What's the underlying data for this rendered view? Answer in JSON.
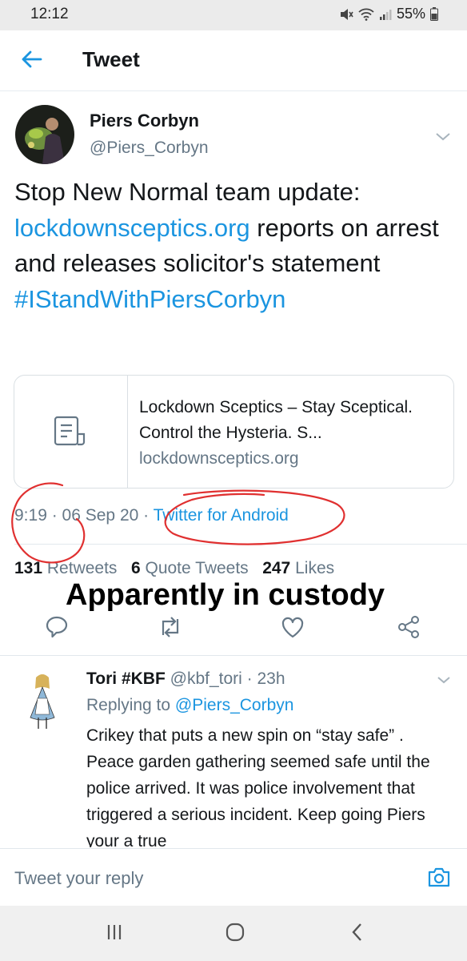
{
  "status_bar": {
    "time": "12:12",
    "battery": "55%"
  },
  "header": {
    "title": "Tweet"
  },
  "tweet": {
    "author_name": "Piers Corbyn",
    "author_handle": "@Piers_Corbyn",
    "text_part1": "Stop New Normal team update: ",
    "text_link": "lockdownsceptics.org",
    "text_part2": " reports on arrest and releases solicitor's statement ",
    "hashtag": "#IStandWithPiersCorbyn",
    "card": {
      "title": "Lockdown Sceptics – Stay Sceptical. Control the Hysteria. S...",
      "url": "lockdownsceptics.org"
    },
    "time": "9:19",
    "date": "06 Sep 20",
    "source": "Twitter for Android",
    "stats": {
      "retweets_count": "131",
      "retweets_label": "Retweets",
      "quotes_count": "6",
      "quotes_label": "Quote Tweets",
      "likes_count": "247",
      "likes_label": "Likes"
    }
  },
  "overlay_caption": "Apparently in custody",
  "reply": {
    "author_name": "Tori #KBF",
    "author_handle": "@kbf_tori",
    "age": "23h",
    "replying_label": "Replying to ",
    "replying_to": "@Piers_Corbyn",
    "text": "Crikey that puts a new spin on “stay safe” . Peace garden gathering seemed safe until the police arrived. It was police involvement that triggered a serious incident. Keep going Piers your a true"
  },
  "compose": {
    "placeholder": "Tweet your reply"
  },
  "icons": {
    "back": "arrow-left-icon",
    "menu": "chevron-down-icon",
    "card": "document-icon",
    "reply": "speech-bubble-icon",
    "retweet": "retweet-icon",
    "like": "heart-icon",
    "share": "share-icon",
    "camera": "camera-icon"
  },
  "colors": {
    "accent": "#1b95e0",
    "muted": "#657786",
    "annotation": "#e03030"
  }
}
